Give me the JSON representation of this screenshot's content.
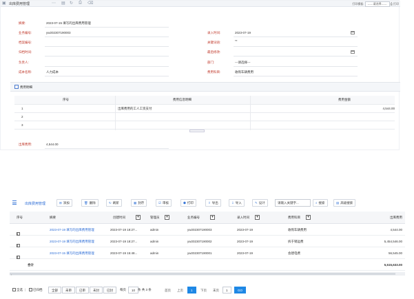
{
  "top": {
    "title": "出库费用管理",
    "print_label": "打印模板:",
    "print_select": "------请选择------",
    "print_button": "打印"
  },
  "form": {
    "summary_label": "摘要:",
    "summary_value": "2023-07-15 填写的出库费用管理",
    "business_no_label": "业务编号:",
    "business_no_value": "yw202307190003",
    "entry_time_label": "录入时间:",
    "entry_time_value": "2023-07-19",
    "archive_no_label": "档案编号:",
    "archive_no_value": "",
    "voucher_label": "关键词语:",
    "voucher_value": "**",
    "edit_time_label": "最后修改:",
    "edit_time_value": "",
    "archive_time_label": "归档时间:",
    "archive_time_value": "",
    "responsible_label": "负责人:",
    "responsible_value": "",
    "dept_label": "部门:",
    "dept_value": "---请选择---",
    "cost_name_label": "成本名称:",
    "cost_name_value": "人力成本",
    "expense_subject_label": "费用科目:",
    "expense_subject_value": "收购车辆费用"
  },
  "detail": {
    "title": "费用明细",
    "columns": [
      "序号",
      "费用信息明细",
      "费用金额"
    ],
    "rows": [
      {
        "no": "1",
        "info": "出库费用的工人工资支付",
        "amount": "4,544.00"
      },
      {
        "no": "2",
        "info": "",
        "amount": ""
      },
      {
        "no": "3",
        "info": "",
        "amount": ""
      }
    ],
    "total_label": "出库费用:",
    "total_value": "4,544.00"
  },
  "toolbar": {
    "title": "出库费用管理",
    "add": "添加",
    "delete": "删除",
    "refresh": "刷新",
    "save": "封存",
    "audit": "审核",
    "print": "打印",
    "export": "导出",
    "import": "导入",
    "design": "设计",
    "search_placeholder": "请输入关键字...",
    "search": "搜索",
    "advanced_search": "高级搜索"
  },
  "grid": {
    "columns": {
      "no": "序号",
      "summary": "摘要",
      "created": "创建时间",
      "manager": "管理员",
      "business_no": "业务编号",
      "entry_time": "录入时间",
      "subject": "费用科目",
      "amount": "出库费用"
    },
    "rows": [
      {
        "no": "1",
        "summary": "2023-07-19 填写的出库费用管理",
        "created": "2023-07-19 18:27...",
        "manager": "admin",
        "business_no": "yw202307190003",
        "entry_time": "2023-07-19",
        "subject": "收购车辆费用",
        "amount": "4,544.00"
      },
      {
        "no": "2",
        "summary": "2023-07-19 填写的出库费用管理",
        "created": "2023-07-19 18:27...",
        "manager": "admin",
        "business_no": "yw202307190002",
        "entry_time": "2023-07-19",
        "subject": "拆于销运费",
        "amount": "5,454,546.00"
      },
      {
        "no": "3",
        "summary": "2023-07-15 填写的出库费用管理",
        "created": "2023-07-19 15:48...",
        "manager": "admin",
        "business_no": "yw202307190001",
        "entry_time": "2023-07-19",
        "subject": "会建电费",
        "amount": "56,545.00"
      }
    ],
    "total_label": "合计",
    "total_amount": "5,515,633.00"
  },
  "pager": {
    "select_all": "全选",
    "archived": "已归档",
    "filters": [
      "全部",
      "未审",
      "已审",
      "未封",
      "已封"
    ],
    "per_page_label": "每页",
    "per_page_value": "10",
    "summary": "条 共 3 条",
    "first": "首页",
    "prev": "上页",
    "current": "1",
    "next": "下页",
    "last": "末页",
    "goto_value": "1",
    "go": "GO"
  }
}
